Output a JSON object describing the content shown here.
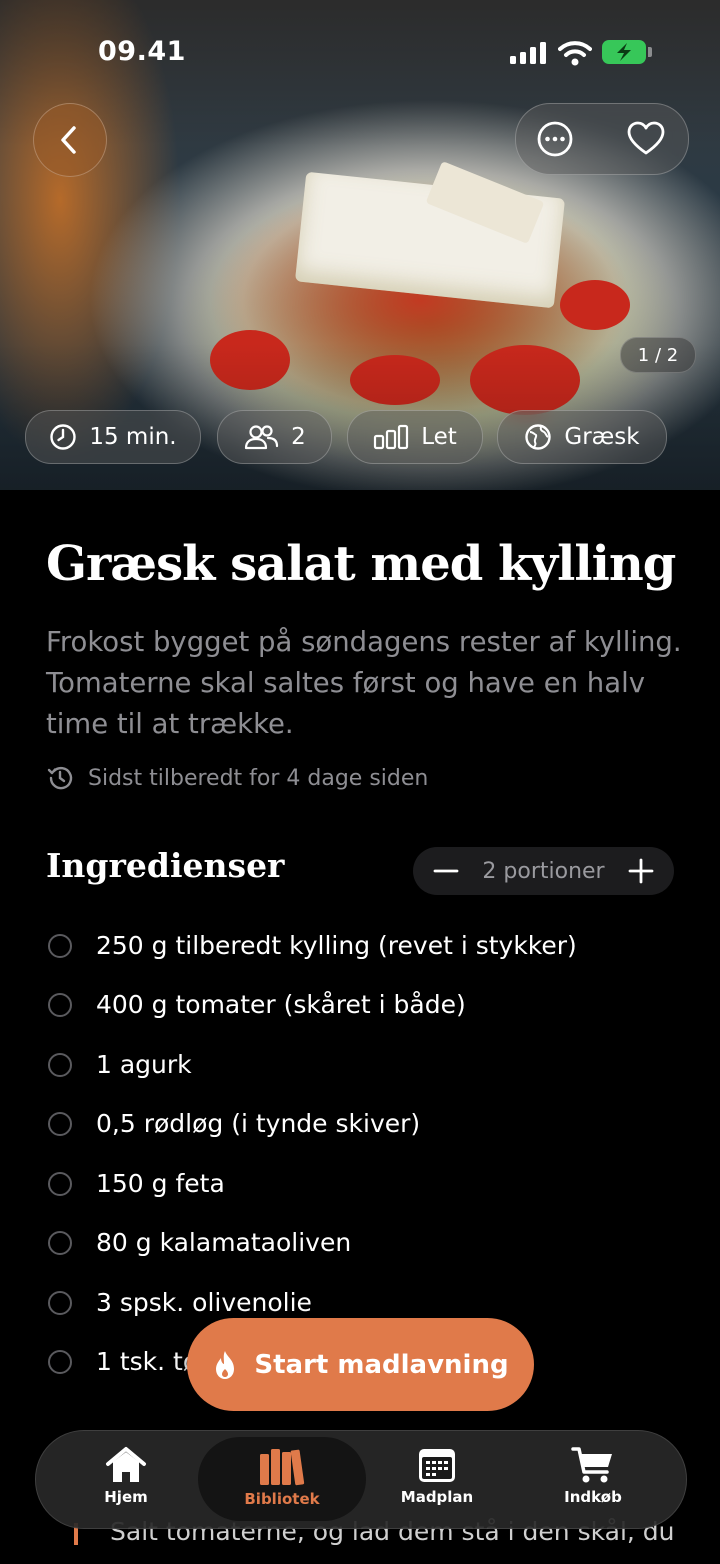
{
  "status": {
    "time": "09.41"
  },
  "hero": {
    "image_counter": "1 / 2"
  },
  "meta": {
    "time": "15 min.",
    "servings": "2",
    "difficulty": "Let",
    "cuisine": "Græsk"
  },
  "recipe": {
    "title": "Græsk salat med kylling",
    "description": "Frokost bygget på søndagens rester af kylling. Tomaterne skal saltes først og have en halv time til at trække.",
    "last_cooked": "Sidst tilberedt for 4 dage siden"
  },
  "ingredients": {
    "heading": "Ingredienser",
    "portions_label": "2 portioner",
    "items": [
      "250 g tilberedt kylling (revet i stykker)",
      "400 g tomater (skåret i både)",
      "1 agurk",
      "0,5 rødløg (i tynde skiver)",
      "150 g feta",
      "80 g kalamataoliven",
      "3 spsk. olivenolie",
      "1 tsk. tø"
    ]
  },
  "cta": {
    "label": "Start madlavning"
  },
  "behind_text": "Salt tomaterne, og lad dem stå i den skål, du",
  "tabs": [
    {
      "label": "Hjem",
      "icon": "home-icon"
    },
    {
      "label": "Bibliotek",
      "icon": "library-icon"
    },
    {
      "label": "Madplan",
      "icon": "calendar-icon"
    },
    {
      "label": "Indkøb",
      "icon": "cart-icon"
    }
  ],
  "colors": {
    "accent": "#E07A4A",
    "battery": "#37C759",
    "background": "#000000"
  }
}
